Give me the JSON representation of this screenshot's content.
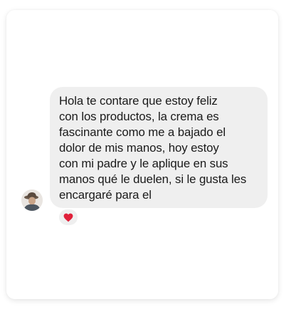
{
  "conversation": {
    "message": {
      "text": "Hola te contare que estoy feliz\ncon los productos, la crema es\nfascinante como me a bajado el\ndolor de mis manos, hoy estoy\ncon mi padre y le aplique en sus\nmanos qué le duelen, si le gusta les\nencargaré para el",
      "reaction_icon": "heart-icon",
      "reaction_color": "#e0203a"
    },
    "avatar_icon": "user-avatar",
    "colors": {
      "bubble": "#efefef",
      "text": "#1a1a1a"
    }
  }
}
